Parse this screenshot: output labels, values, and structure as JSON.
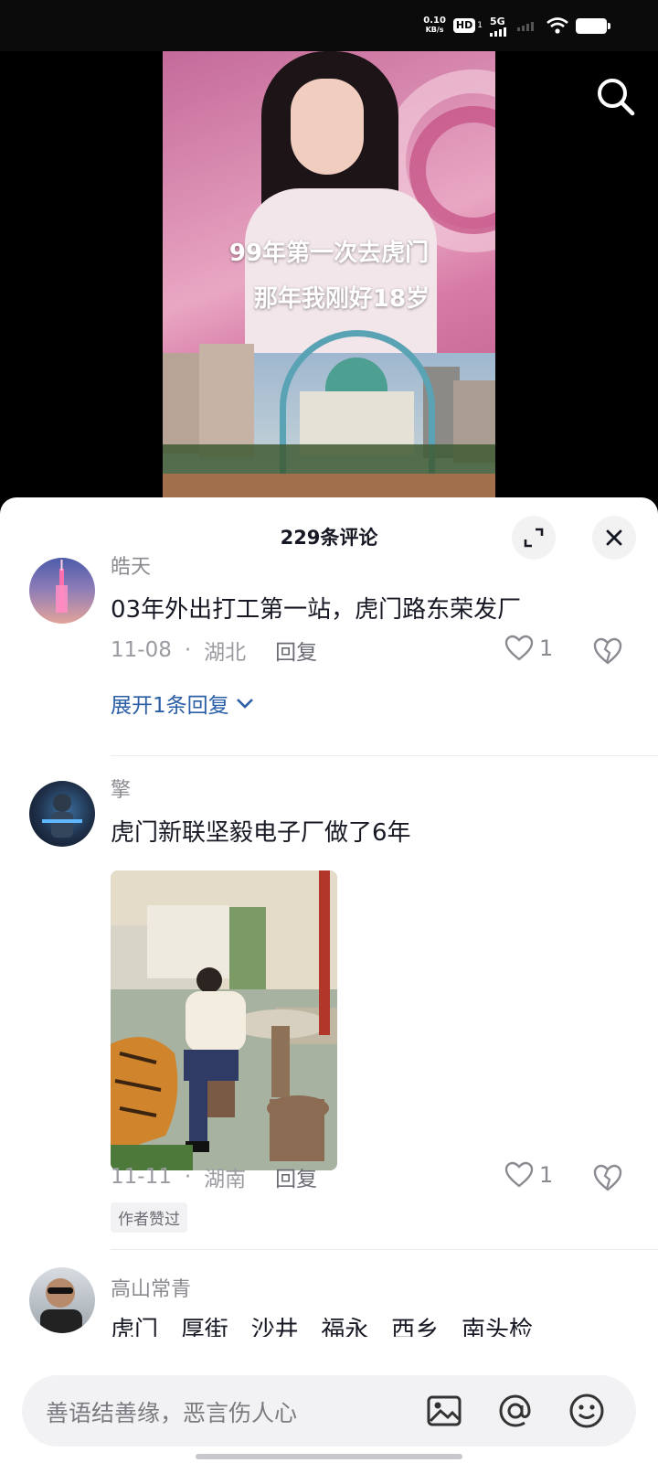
{
  "status_bar": {
    "net_speed_value": "0.10",
    "net_speed_unit": "KB/s",
    "hd_label": "HD",
    "hd_sub": "1",
    "network": "5G"
  },
  "video": {
    "caption_line1": "99年第一次去虎门",
    "caption_line2": "那年我刚好18岁"
  },
  "comments_sheet": {
    "title": "229条评论"
  },
  "comments": [
    {
      "username": "皓天",
      "text": "03年外出打工第一站，虎门路东荣发厂",
      "date": "11-08",
      "location": "湖北",
      "reply_label": "回复",
      "likes": "1",
      "expand_replies": "展开1条回复"
    },
    {
      "username": "擎",
      "text": "虎门新联坚毅电子厂做了6年",
      "date": "11-11",
      "location": "湖南",
      "reply_label": "回复",
      "likes": "1",
      "badge": "作者赞过"
    },
    {
      "username": "高山常青",
      "text": "虎门   厚街   沙井   福永   西乡   南头检"
    }
  ],
  "input_bar": {
    "placeholder": "善语结善缘，恶言伤人心"
  },
  "icons": {
    "search": "search-icon",
    "expand": "expand-icon",
    "close": "close-icon",
    "heart": "heart-icon",
    "dislike": "broken-heart-icon",
    "image": "image-icon",
    "mention": "at-icon",
    "emoji": "emoji-icon"
  }
}
